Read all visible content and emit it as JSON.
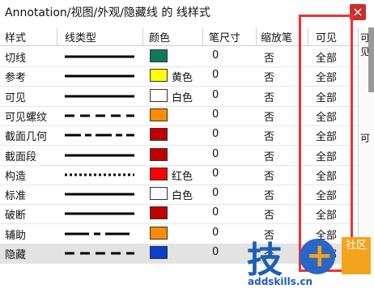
{
  "window": {
    "title": "Annotation/视图/外观/隐藏线 的 线样式",
    "close_glyph": "×"
  },
  "columns": [
    "样式",
    "线类型",
    "颜色",
    "笔尺寸",
    "缩放笔",
    "可见"
  ],
  "rows": [
    {
      "name": "切线",
      "line": "solid",
      "color": "#0f7a5a",
      "color_label": "",
      "pen": "0",
      "scale": "否",
      "visible": "全部"
    },
    {
      "name": "参考",
      "line": "solid",
      "color": "#ffff00",
      "color_label": "黄色",
      "pen": "0",
      "scale": "否",
      "visible": "全部"
    },
    {
      "name": "可见",
      "line": "solid",
      "color": "#ffffff",
      "color_label": "白色",
      "pen": "0",
      "scale": "否",
      "visible": "全部"
    },
    {
      "name": "可见螺纹",
      "line": "dash",
      "color": "#ff8c00",
      "color_label": "",
      "pen": "0",
      "scale": "否",
      "visible": "全部"
    },
    {
      "name": "截面几何",
      "line": "dashdot",
      "color": "#c00000",
      "color_label": "",
      "pen": "0",
      "scale": "否",
      "visible": "全部"
    },
    {
      "name": "截面段",
      "line": "solid",
      "color": "#c00000",
      "color_label": "",
      "pen": "0",
      "scale": "否",
      "visible": "全部"
    },
    {
      "name": "构造",
      "line": "dotted",
      "color": "#ff0000",
      "color_label": "红色",
      "pen": "0",
      "scale": "否",
      "visible": "全部"
    },
    {
      "name": "标准",
      "line": "solid",
      "color": "#ffffff",
      "color_label": "白色",
      "pen": "0",
      "scale": "否",
      "visible": "全部"
    },
    {
      "name": "破断",
      "line": "solid",
      "color": "#c00000",
      "color_label": "",
      "pen": "0",
      "scale": "否",
      "visible": "全部"
    },
    {
      "name": "辅助",
      "line": "dashdot2",
      "color": "#ff8c00",
      "color_label": "",
      "pen": "0",
      "scale": "否",
      "visible": "全部"
    },
    {
      "name": "隐藏",
      "line": "dash",
      "color": "#0b3fd0",
      "color_label": "",
      "pen": "0",
      "scale": "否",
      "visible": "全部"
    }
  ],
  "right_pane": [
    "可见",
    "可"
  ],
  "watermark": {
    "glyph": "技",
    "plus": "+",
    "tag": "社区",
    "url": "addskills.cn"
  }
}
